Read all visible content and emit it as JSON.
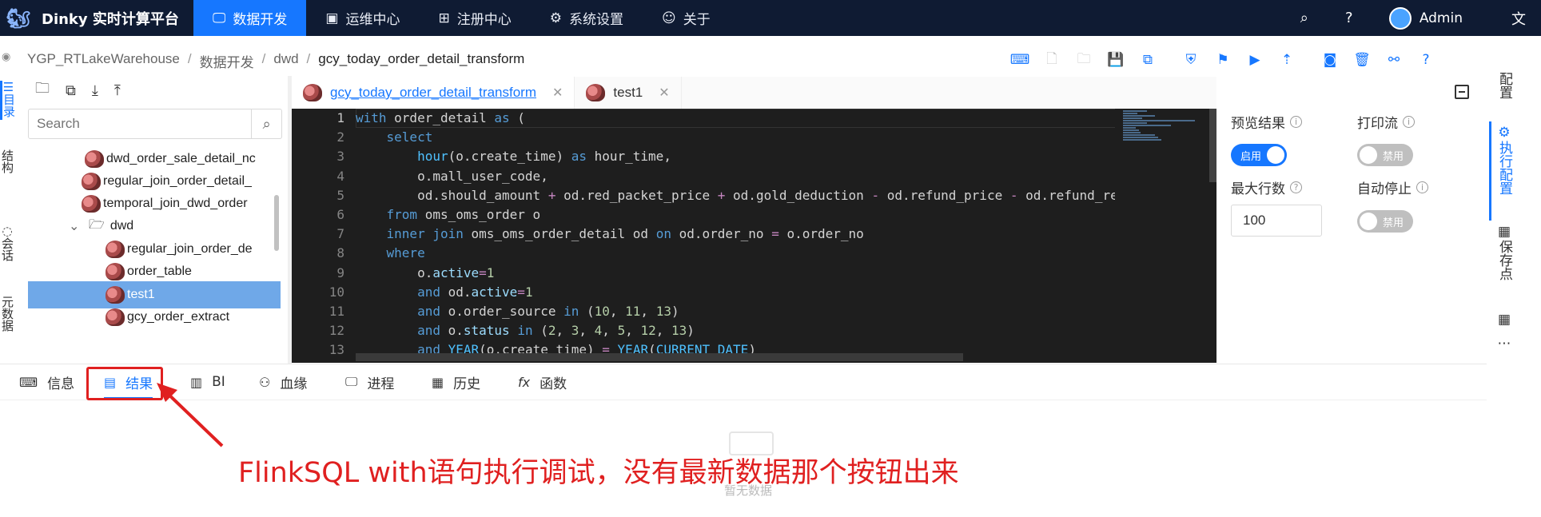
{
  "app": {
    "title": "Dinky 实时计算平台"
  },
  "nav": {
    "items": [
      {
        "label": "数据开发",
        "icon": "monitor-icon",
        "active": true
      },
      {
        "label": "运维中心",
        "icon": "dashboard-icon",
        "active": false
      },
      {
        "label": "注册中心",
        "icon": "grid-icon",
        "active": false
      },
      {
        "label": "系统设置",
        "icon": "gear-icon",
        "active": false
      },
      {
        "label": "关于",
        "icon": "smile-icon",
        "active": false
      }
    ],
    "user": "Admin"
  },
  "breadcrumb": [
    "YGP_RTLakeWarehouse",
    "数据开发",
    "dwd",
    "gcy_today_order_detail_transform"
  ],
  "leftrail": [
    "目录",
    "结构",
    "会话",
    "元数据"
  ],
  "search": {
    "placeholder": "Search"
  },
  "tree": [
    {
      "label": "dwd_order_sale_detail_nc",
      "level": 2,
      "type": "flink"
    },
    {
      "label": "regular_join_order_detail_",
      "level": 2,
      "type": "flink"
    },
    {
      "label": "temporal_join_dwd_order",
      "level": 2,
      "type": "flink"
    },
    {
      "label": "dwd",
      "level": 1,
      "type": "folder"
    },
    {
      "label": "regular_join_order_de",
      "level": 3,
      "type": "flink"
    },
    {
      "label": "order_table",
      "level": 3,
      "type": "flink"
    },
    {
      "label": "test1",
      "level": 3,
      "type": "flink",
      "selected": true
    },
    {
      "label": "gcy_order_extract",
      "level": 3,
      "type": "flink"
    }
  ],
  "tabs": [
    {
      "label": "gcy_today_order_detail_transform",
      "active": true
    },
    {
      "label": "test1",
      "active": false
    }
  ],
  "code": {
    "lines": [
      "with order_detail as (",
      "    select",
      "        hour(o.create_time) as hour_time,",
      "        o.mall_user_code,",
      "        od.should_amount + od.red_packet_price + od.gold_deduction - od.refund_price - od.refund_red",
      "    from oms_oms_order o",
      "    inner join oms_oms_order_detail od on od.order_no = o.order_no",
      "    where",
      "        o.active=1",
      "        and od.active=1",
      "        and o.order_source in (10, 11, 13)",
      "        and o.status in (2, 3, 4, 5, 12, 13)",
      "        and YEAR(o.create_time) = YEAR(CURRENT_DATE)"
    ],
    "line_numbers": [
      "1",
      "2",
      "3",
      "4",
      "5",
      "6",
      "7",
      "8",
      "9",
      "10",
      "11",
      "12",
      "13"
    ]
  },
  "config": {
    "preview_result": "预览结果",
    "print_stream": "打印流",
    "max_rows": "最大行数",
    "auto_stop": "自动停止",
    "switch_on": "启用",
    "switch_off": "禁用",
    "max_rows_value": "100"
  },
  "rightrail": [
    "配置",
    "执行配置",
    "保存点"
  ],
  "bottom_tabs": [
    {
      "label": "信息",
      "icon": "terminal-icon"
    },
    {
      "label": "结果",
      "icon": "table-icon",
      "active": true
    },
    {
      "label": "BI",
      "icon": "bar-chart-icon"
    },
    {
      "label": "血缘",
      "icon": "lineage-icon"
    },
    {
      "label": "进程",
      "icon": "desktop-icon"
    },
    {
      "label": "历史",
      "icon": "calendar-icon"
    },
    {
      "label": "函数",
      "icon": "function-icon"
    }
  ],
  "empty": {
    "text": "暂无数据"
  },
  "annotation": "FlinkSQL with语句执行调试，没有最新数据那个按钮出来",
  "colors": {
    "nav_bg": "#0f1b33",
    "accent": "#1677ff",
    "annotation": "#e02020",
    "editor_bg": "#1e1e1e"
  }
}
